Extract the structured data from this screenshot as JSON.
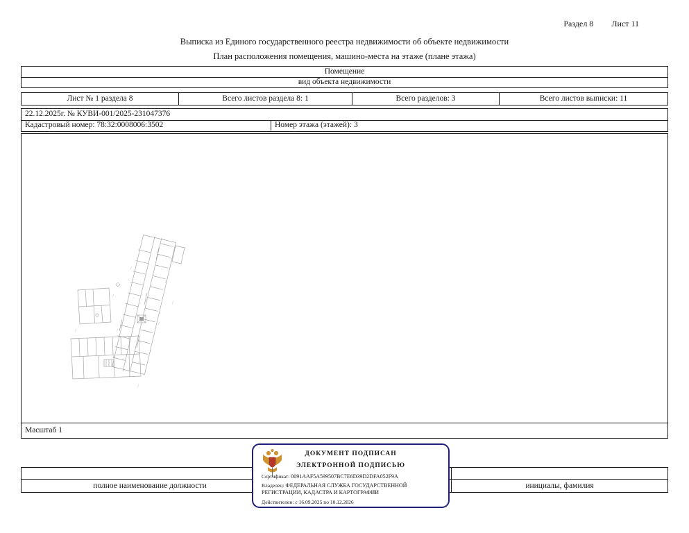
{
  "page": {
    "section_label": "Раздел 8",
    "sheet_label": "Лист 11",
    "title_line1": "Выписка из Единого государственного реестра недвижимости об объекте недвижимости",
    "title_line2": "План расположения помещения, машино-места на этаже (плане этажа)"
  },
  "object_type_table": {
    "value": "Помещение",
    "caption": "вид объекта недвижимости"
  },
  "sheet_info_table": {
    "cells": [
      "Лист № 1 раздела 8",
      "Всего листов раздела 8: 1",
      "Всего разделов: 3",
      "Всего листов выписки: 11"
    ]
  },
  "details_table": {
    "date_number": "22.12.2025г. № КУВИ-001/2025-231047376",
    "cadastral_number": "Кадастровый номер: 78:32:0008006:3502",
    "floor_number": "Номер этажа (этажей): 3"
  },
  "plan": {
    "scale_label": "Масштаб 1"
  },
  "signature_block": {
    "position_label": "полное наименование должности",
    "name_label": "инициалы, фамилия"
  },
  "stamp": {
    "line1": "ДОКУМЕНТ ПОДПИСАН",
    "line2": "ЭЛЕКТРОННОЙ ПОДПИСЬЮ",
    "certificate_label": "Сертификат:",
    "certificate_value": "0091AAF5A599507BC7E6D39D2DFA052F9A",
    "owner_label": "Владелец:",
    "owner_value": "ФЕДЕРАЛЬНАЯ СЛУЖБА ГОСУДАРСТВЕННОЙ РЕГИСТРАЦИИ, КАДАСТРА И КАРТОГРАФИИ",
    "validity_label": "Действителен:",
    "validity_value": "с 16.09.2025 по 10.12.2026",
    "border_color": "#20207a",
    "emblem_gold": "#cf9430",
    "emblem_red": "#b5372a"
  }
}
